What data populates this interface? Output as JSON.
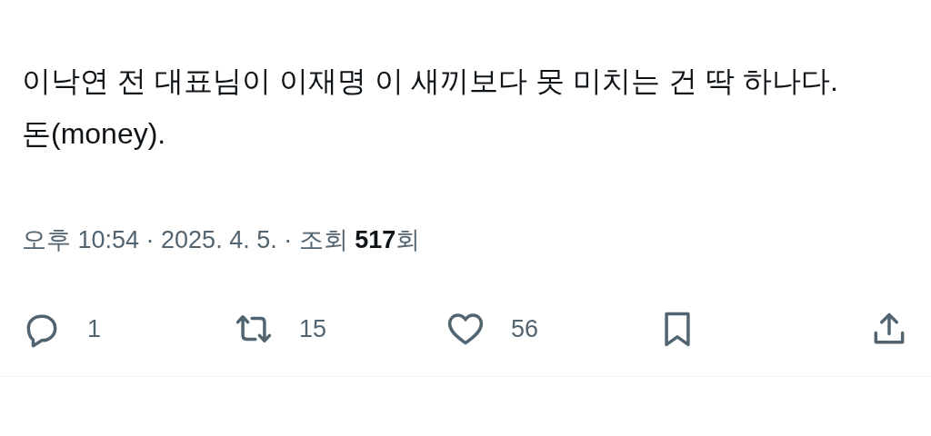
{
  "post": {
    "paragraphs": [
      "이낙연 전 대표님이 이재명 이 새끼보다 못 미치는 건 딱 하나다.",
      "돈(money)."
    ],
    "meta": "오후 10:54 · 2025. 4. 5. · 조회 **517**회",
    "actions": [
      {
        "kind": "reply",
        "count": "1"
      },
      {
        "kind": "repost",
        "count": "15"
      },
      {
        "kind": "like",
        "count": "56"
      },
      {
        "kind": "bookmark"
      },
      {
        "kind": "share"
      }
    ]
  }
}
